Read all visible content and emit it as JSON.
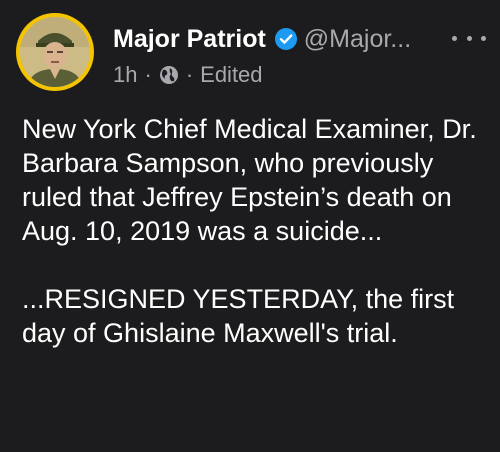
{
  "post": {
    "author": {
      "name": "Major Patriot",
      "handle": "@Major...",
      "verified": true,
      "avatar_ring_color": "#f5c400"
    },
    "meta": {
      "time": "1h",
      "separator": "·",
      "audience_icon": "globe-icon",
      "status": "Edited"
    },
    "menu_icon": "more-horizontal-icon",
    "body": {
      "paragraph_1": "New York Chief Medical Examiner, Dr. Barbara Sampson, who previously ruled that Jeffrey Epstein’s death on Aug. 10, 2019 was a suicide...",
      "paragraph_2": "...RESIGNED YESTERDAY, the first day of Ghislaine Maxwell's trial."
    }
  },
  "colors": {
    "background": "#1c1c1e",
    "text_primary": "#ffffff",
    "text_secondary": "#a8a8ae",
    "verified_badge": "#1d9bf0"
  }
}
